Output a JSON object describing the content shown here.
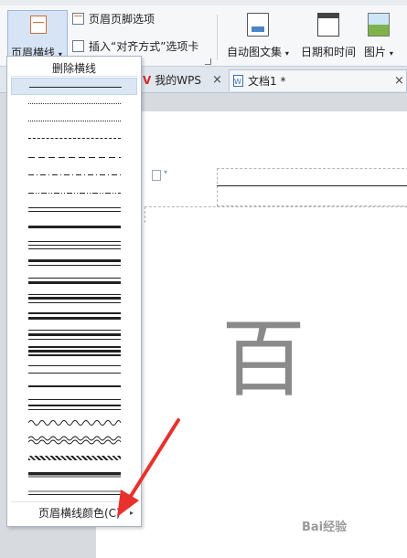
{
  "ribbon": {
    "header_line_button": "页眉横线",
    "header_footer_options": "页眉页脚选项",
    "insert_align_tab": "插入“对齐方式”选项卡",
    "auto_text": "自动图文集",
    "date_time": "日期和时间",
    "picture": "图片"
  },
  "tabs": [
    {
      "label": "我的WPS"
    },
    {
      "label": "文档1 *"
    }
  ],
  "dropdown": {
    "delete_line": "删除横线",
    "footer_item": "页眉横线颜色(C)",
    "line_styles": [
      "single-thin-selected",
      "dotted-fine",
      "dotted",
      "dashed-short",
      "dashed-long",
      "dash-dot",
      "dash-dot-dot",
      "double-thin",
      "thick",
      "triple",
      "thick-thin",
      "thin-thick",
      "thick-thin-double",
      "thick-bar",
      "thin-thick-thin",
      "triple-heavy",
      "double-spaced",
      "single-thick",
      "thin-thick-spaced",
      "wavy",
      "double-wavy",
      "diagonal-hatched",
      "embossed",
      "engraved",
      "outset",
      "inset"
    ]
  },
  "document": {
    "big_char": "百"
  },
  "watermark": "Bai经验",
  "colors": {
    "annotation_arrow": "#e8312c",
    "selection": "#dbe6f4"
  }
}
